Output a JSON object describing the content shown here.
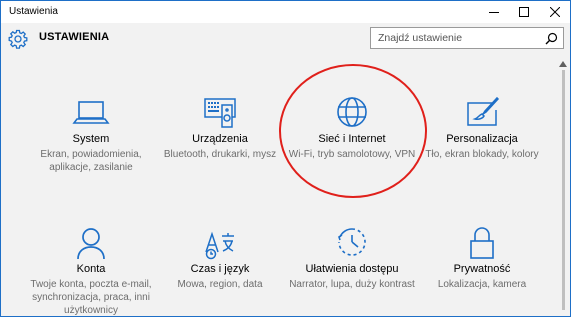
{
  "window": {
    "title": "Ustawienia"
  },
  "header": {
    "title": "USTAWIENIA",
    "search_placeholder": "Znajdź ustawienie"
  },
  "accent_color": "#1e6fc7",
  "highlight_color": "#e0201b",
  "tiles": [
    {
      "name": "System",
      "desc": "Ekran, powiadomienia, aplikacje, zasilanie",
      "icon": "laptop-icon"
    },
    {
      "name": "Urządzenia",
      "desc": "Bluetooth, drukarki, mysz",
      "icon": "devices-icon"
    },
    {
      "name": "Sieć i Internet",
      "desc": "Wi-Fi, tryb samolotowy, VPN",
      "icon": "globe-icon"
    },
    {
      "name": "Personalizacja",
      "desc": "Tło, ekran blokady, kolory",
      "icon": "paintbrush-icon"
    },
    {
      "name": "Konta",
      "desc": "Twoje konta, poczta e-mail, synchronizacja, praca, inni użytkownicy",
      "icon": "person-icon"
    },
    {
      "name": "Czas i język",
      "desc": "Mowa, region, data",
      "icon": "time-language-icon"
    },
    {
      "name": "Ułatwienia dostępu",
      "desc": "Narrator, lupa, duży kontrast",
      "icon": "ease-of-access-icon"
    },
    {
      "name": "Prywatność",
      "desc": "Lokalizacja, kamera",
      "icon": "lock-icon"
    }
  ]
}
